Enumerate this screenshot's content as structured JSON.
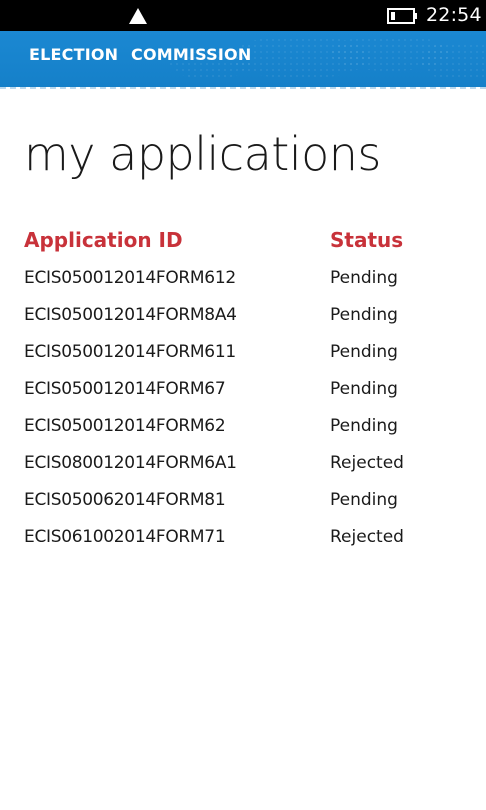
{
  "status_bar": {
    "time": "22:54",
    "icons": [
      "signal-icon",
      "battery-icon"
    ]
  },
  "header": {
    "title": "ELECTION  COMMISSION"
  },
  "page": {
    "title": "my applications"
  },
  "table": {
    "columns": [
      "Application ID",
      "Status"
    ],
    "rows": [
      {
        "id": "ECIS050012014FORM612",
        "status": "Pending"
      },
      {
        "id": "ECIS050012014FORM8A4",
        "status": "Pending"
      },
      {
        "id": "ECIS050012014FORM611",
        "status": "Pending"
      },
      {
        "id": "ECIS050012014FORM67",
        "status": "Pending"
      },
      {
        "id": "ECIS050012014FORM62",
        "status": "Pending"
      },
      {
        "id": "ECIS080012014FORM6A1",
        "status": "Rejected"
      },
      {
        "id": "ECIS050062014FORM81",
        "status": "Pending"
      },
      {
        "id": "ECIS061002014FORM71",
        "status": "Rejected"
      }
    ]
  },
  "colors": {
    "header_blue": "#1580c9",
    "column_header_red": "#c8323a",
    "status_bar": "#000000"
  }
}
